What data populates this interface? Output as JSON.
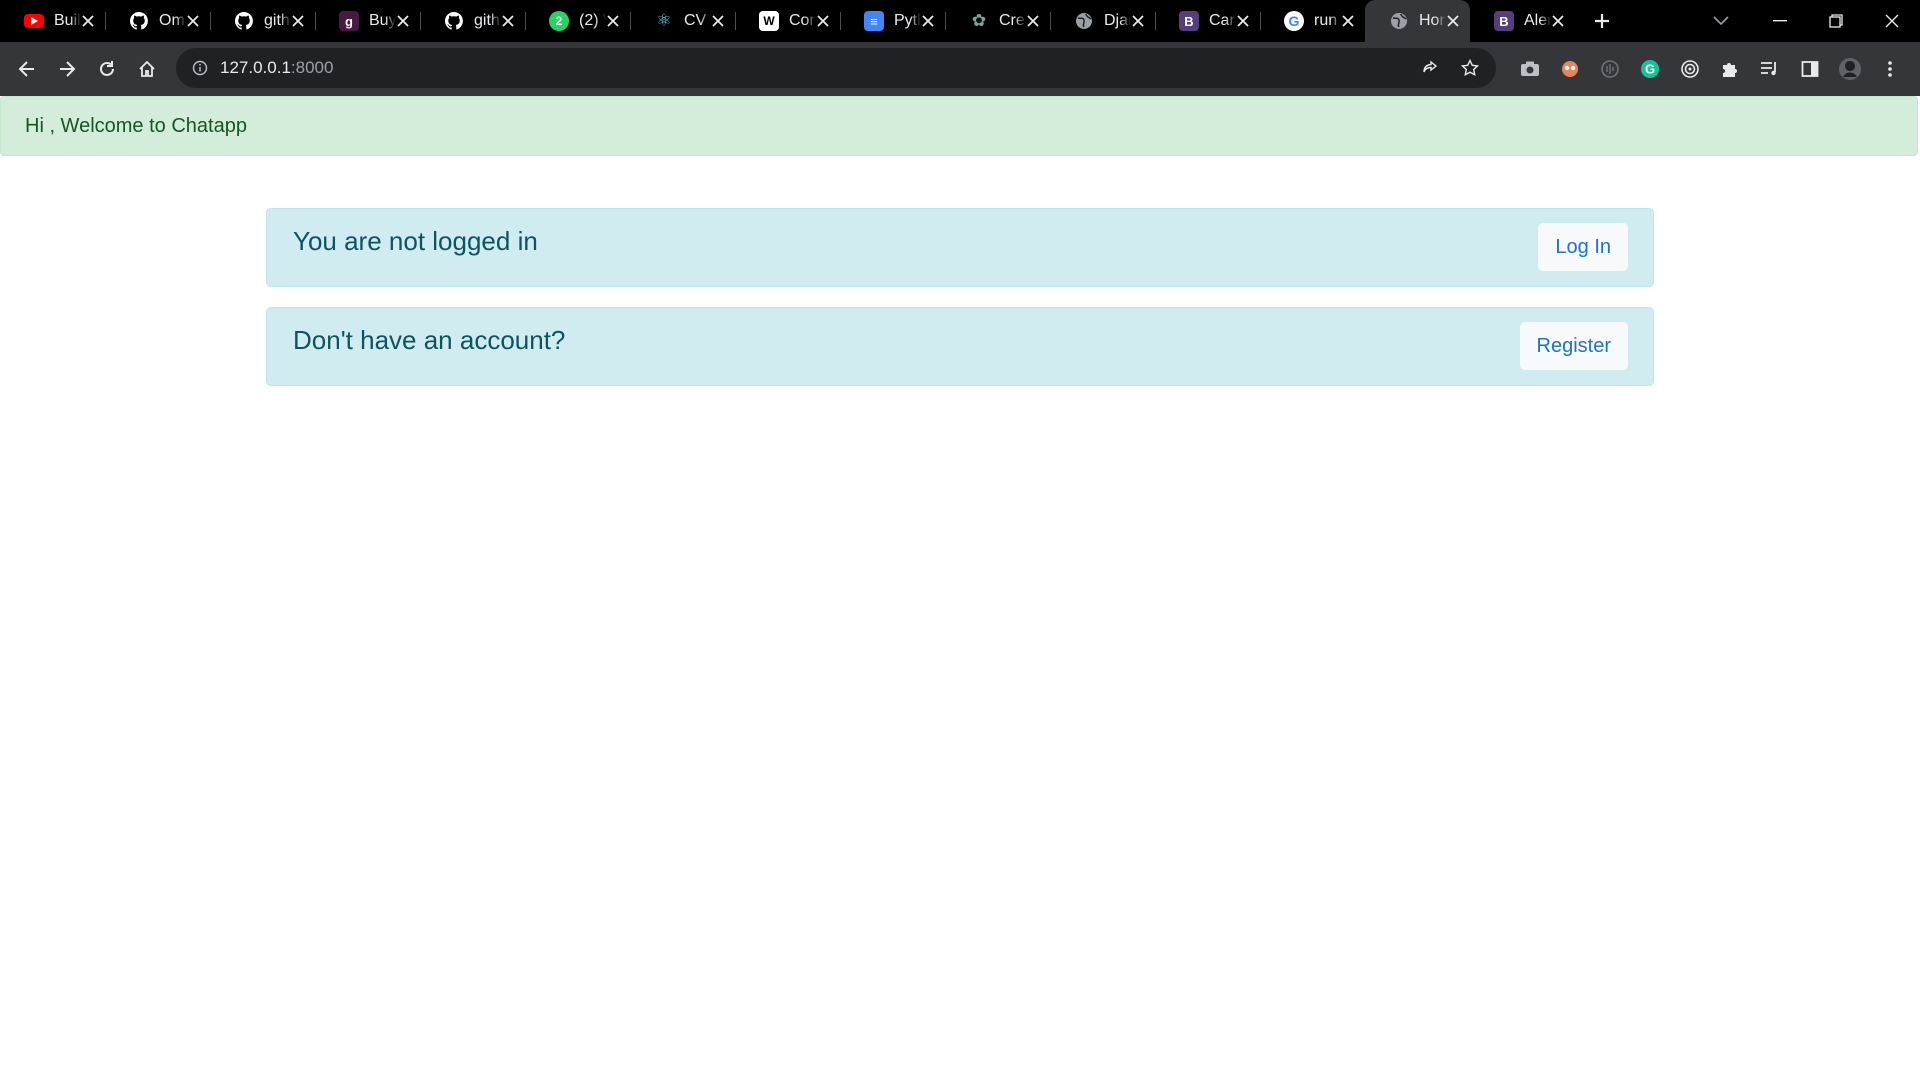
{
  "browser": {
    "tabs": [
      {
        "title": "Buil",
        "icon": "youtube-icon",
        "color": "#ff0000",
        "glyph": "▶"
      },
      {
        "title": "Om",
        "icon": "github-icon",
        "color": "#ffffff",
        "glyph": ""
      },
      {
        "title": "gith",
        "icon": "github-icon",
        "color": "#ffffff",
        "glyph": ""
      },
      {
        "title": "Buy",
        "icon": "gumroad-icon",
        "color": "#4a1942",
        "glyph": "ɡ"
      },
      {
        "title": "gith",
        "icon": "github-icon",
        "color": "#ffffff",
        "glyph": ""
      },
      {
        "title": "(2) \\",
        "icon": "whatsapp-icon",
        "color": "#25d366",
        "glyph": "2"
      },
      {
        "title": "CV |",
        "icon": "react-icon",
        "color": "#61dafb",
        "glyph": "⚛"
      },
      {
        "title": "Cor",
        "icon": "w3schools-icon",
        "color": "#ffffff",
        "glyph": "W"
      },
      {
        "title": "Pytl",
        "icon": "google-docs-icon",
        "color": "#4285f4",
        "glyph": "≡"
      },
      {
        "title": "Cre",
        "icon": "chatgpt-icon",
        "color": "#74aa9c",
        "glyph": "✿"
      },
      {
        "title": "Djar",
        "icon": "globe-icon",
        "color": "#9aa0a6",
        "glyph": "◍"
      },
      {
        "title": "Car",
        "icon": "bootstrap-icon",
        "color": "#563d7c",
        "glyph": "B"
      },
      {
        "title": "run",
        "icon": "google-icon",
        "color": "#ffffff",
        "glyph": "G"
      },
      {
        "title": "Hor",
        "icon": "globe-icon",
        "color": "#9aa0a6",
        "glyph": "◍",
        "active": true
      },
      {
        "title": "Aler",
        "icon": "bootstrap-icon",
        "color": "#563d7c",
        "glyph": "B"
      }
    ],
    "url_host": "127.0.0.1",
    "url_port": ":8000"
  },
  "page": {
    "welcome": "Hi , Welcome to Chatapp",
    "login_card": {
      "text": "You are not logged in",
      "button": "Log In"
    },
    "register_card": {
      "text": "Don't have an account?",
      "button": "Register"
    }
  },
  "colors": {
    "success_bg": "#d4edda",
    "info_bg": "#d1ecf1",
    "link": "#1f73c4"
  }
}
